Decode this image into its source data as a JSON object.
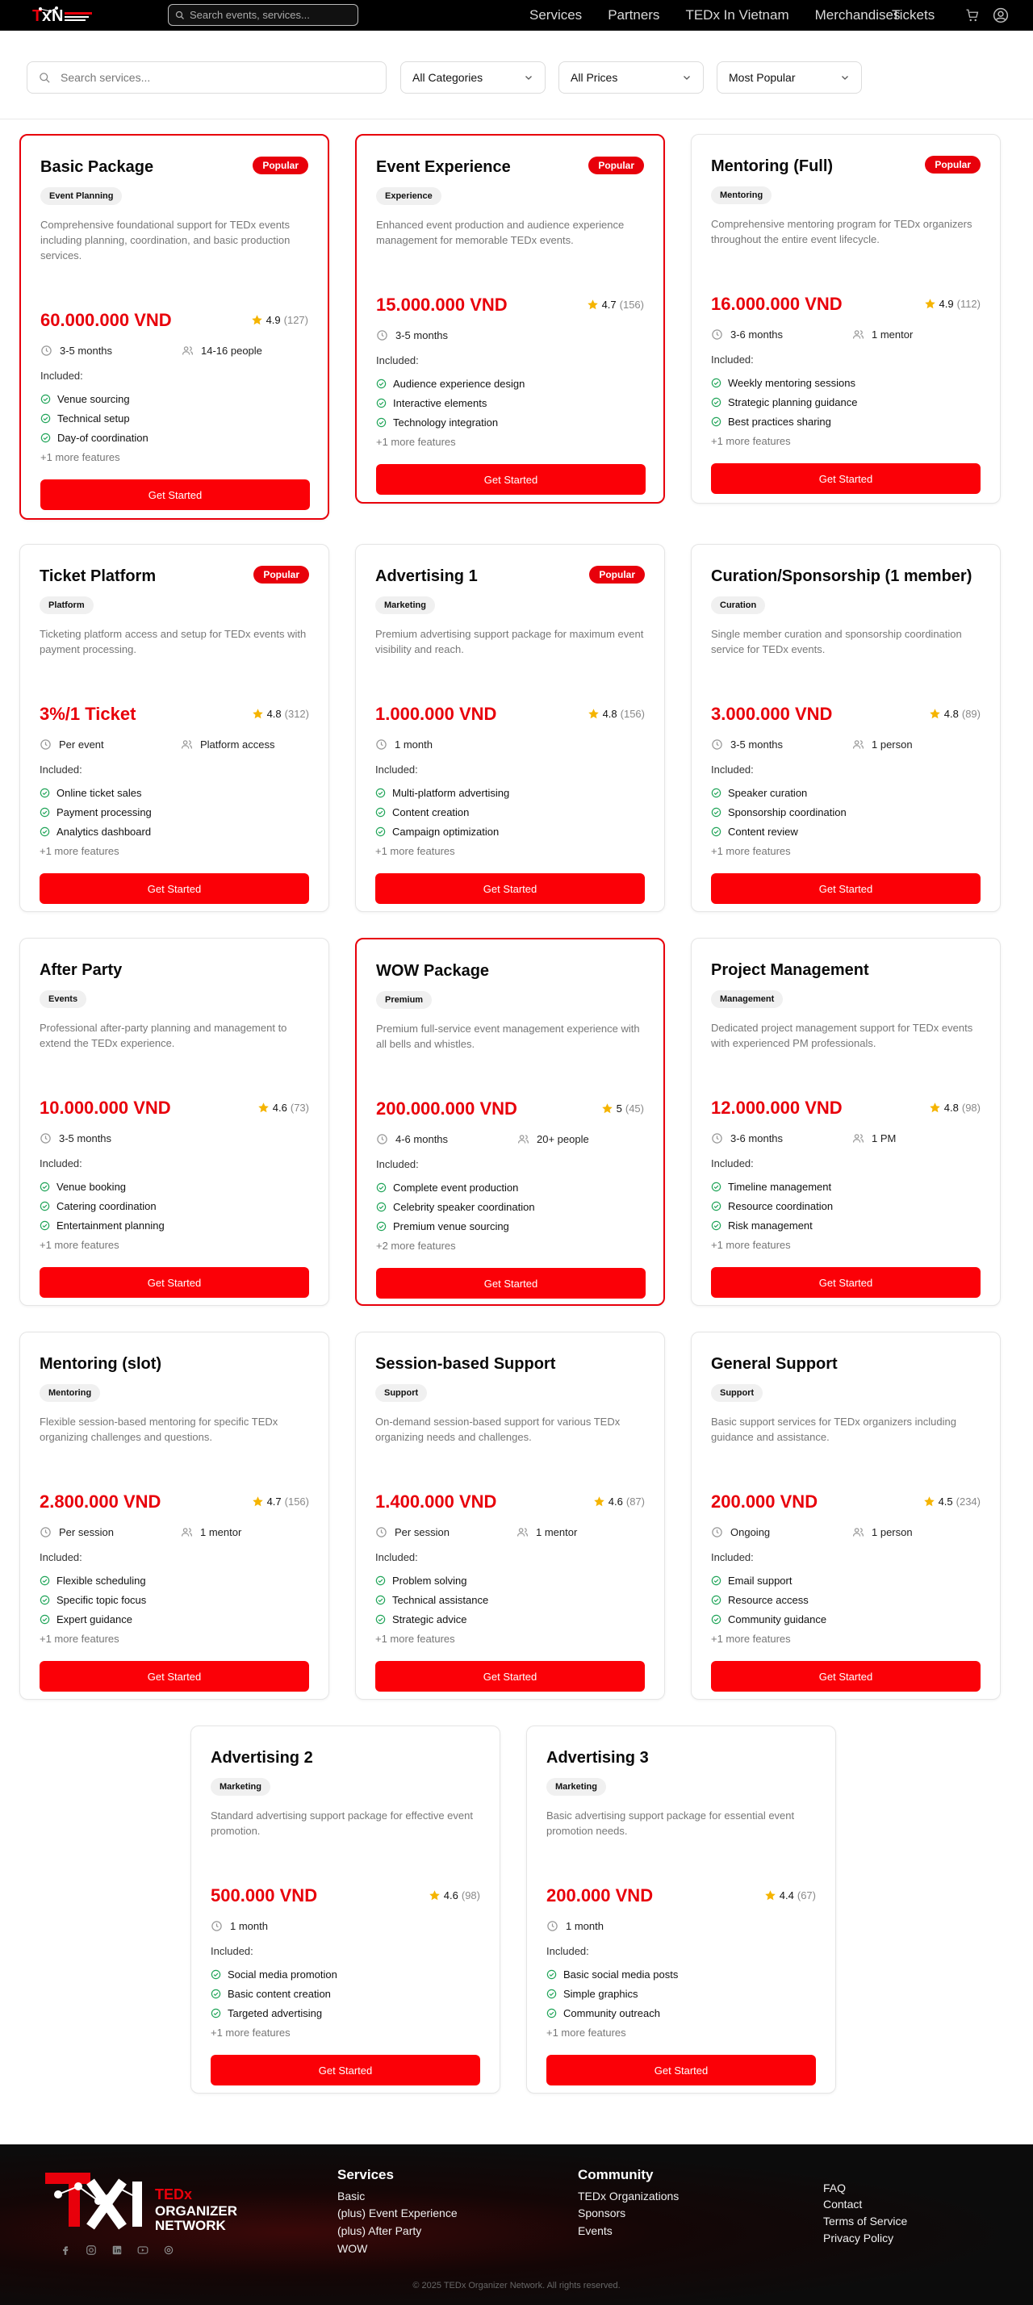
{
  "nav": {
    "search_placeholder": "Search events, services...",
    "links": [
      "Services",
      "Partners",
      "TEDx In Vietnam",
      "Merchandises"
    ],
    "tickets": "Tickets"
  },
  "filters": {
    "search_placeholder": "Search services...",
    "category": "All Categories",
    "price": "All Prices",
    "sort": "Most Popular"
  },
  "common": {
    "included_label": "Included:",
    "button_label": "Get Started",
    "popular_label": "Popular"
  },
  "services": [
    {
      "title": "Basic Package",
      "popular": true,
      "category": "Event Planning",
      "description": "Comprehensive foundational support for TEDx events including planning, coordination, and basic production services.",
      "price": "60.000.000 VND",
      "rating": "4.9",
      "reviews": "(127)",
      "duration": "3-5 months",
      "team": "14-16 people",
      "features": [
        "Venue sourcing",
        "Technical setup",
        "Day-of coordination"
      ],
      "more": "+1 more features"
    },
    {
      "title": "Event Experience",
      "popular": true,
      "category": "Experience",
      "description": "Enhanced event production and audience experience management for memorable TEDx events.",
      "price": "15.000.000 VND",
      "rating": "4.7",
      "reviews": "(156)",
      "duration": "3-5 months",
      "team": "",
      "features": [
        "Audience experience design",
        "Interactive elements",
        "Technology integration"
      ],
      "more": "+1 more features"
    },
    {
      "title": "Mentoring (Full)",
      "popular": true,
      "category": "Mentoring",
      "description": "Comprehensive mentoring program for TEDx organizers throughout the entire event lifecycle.",
      "price": "16.000.000 VND",
      "rating": "4.9",
      "reviews": "(112)",
      "duration": "3-6 months",
      "team": "1 mentor",
      "features": [
        "Weekly mentoring sessions",
        "Strategic planning guidance",
        "Best practices sharing"
      ],
      "more": "+1 more features"
    },
    {
      "title": "Ticket Platform",
      "popular": true,
      "category": "Platform",
      "description": "Ticketing platform access and setup for TEDx events with payment processing.",
      "price": "3%/1 Ticket",
      "rating": "4.8",
      "reviews": "(312)",
      "duration": "Per event",
      "team": "Platform access",
      "features": [
        "Online ticket sales",
        "Payment processing",
        "Analytics dashboard"
      ],
      "more": "+1 more features"
    },
    {
      "title": "Advertising 1",
      "popular": true,
      "category": "Marketing",
      "description": "Premium advertising support package for maximum event visibility and reach.",
      "price": "1.000.000 VND",
      "rating": "4.8",
      "reviews": "(156)",
      "duration": "1 month",
      "team": "",
      "features": [
        "Multi-platform advertising",
        "Content creation",
        "Campaign optimization"
      ],
      "more": "+1 more features"
    },
    {
      "title": "Curation/Sponsorship (1 member)",
      "popular": false,
      "category": "Curation",
      "description": "Single member curation and sponsorship coordination service for TEDx events.",
      "price": "3.000.000 VND",
      "rating": "4.8",
      "reviews": "(89)",
      "duration": "3-5 months",
      "team": "1 person",
      "features": [
        "Speaker curation",
        "Sponsorship coordination",
        "Content review"
      ],
      "more": "+1 more features"
    },
    {
      "title": "After Party",
      "popular": false,
      "category": "Events",
      "description": "Professional after-party planning and management to extend the TEDx experience.",
      "price": "10.000.000 VND",
      "rating": "4.6",
      "reviews": "(73)",
      "duration": "3-5 months",
      "team": "",
      "features": [
        "Venue booking",
        "Catering coordination",
        "Entertainment planning"
      ],
      "more": "+1 more features"
    },
    {
      "title": "WOW Package",
      "popular": false,
      "category": "Premium",
      "description": "Premium full-service event management experience with all bells and whistles.",
      "price": "200.000.000 VND",
      "rating": "5",
      "reviews": "(45)",
      "duration": "4-6 months",
      "team": "20+ people",
      "features": [
        "Complete event production",
        "Celebrity speaker coordination",
        "Premium venue sourcing"
      ],
      "more": "+2 more features"
    },
    {
      "title": "Project Management",
      "popular": false,
      "category": "Management",
      "description": "Dedicated project management support for TEDx events with experienced PM professionals.",
      "price": "12.000.000 VND",
      "rating": "4.8",
      "reviews": "(98)",
      "duration": "3-6 months",
      "team": "1 PM",
      "features": [
        "Timeline management",
        "Resource coordination",
        "Risk management"
      ],
      "more": "+1 more features"
    },
    {
      "title": "Mentoring (slot)",
      "popular": false,
      "category": "Mentoring",
      "description": "Flexible session-based mentoring for specific TEDx organizing challenges and questions.",
      "price": "2.800.000 VND",
      "rating": "4.7",
      "reviews": "(156)",
      "duration": "Per session",
      "team": "1 mentor",
      "features": [
        "Flexible scheduling",
        "Specific topic focus",
        "Expert guidance"
      ],
      "more": "+1 more features"
    },
    {
      "title": "Session-based Support",
      "popular": false,
      "category": "Support",
      "description": "On-demand session-based support for various TEDx organizing needs and challenges.",
      "price": "1.400.000 VND",
      "rating": "4.6",
      "reviews": "(87)",
      "duration": "Per session",
      "team": "1 mentor",
      "features": [
        "Problem solving",
        "Technical assistance",
        "Strategic advice"
      ],
      "more": "+1 more features"
    },
    {
      "title": "General Support",
      "popular": false,
      "category": "Support",
      "description": "Basic support services for TEDx organizers including guidance and assistance.",
      "price": "200.000 VND",
      "rating": "4.5",
      "reviews": "(234)",
      "duration": "Ongoing",
      "team": "1 person",
      "features": [
        "Email support",
        "Resource access",
        "Community guidance"
      ],
      "more": "+1 more features"
    },
    {
      "title": "Advertising 2",
      "popular": false,
      "category": "Marketing",
      "description": "Standard advertising support package for effective event promotion.",
      "price": "500.000 VND",
      "rating": "4.6",
      "reviews": "(98)",
      "duration": "1 month",
      "team": "",
      "features": [
        "Social media promotion",
        "Basic content creation",
        "Targeted advertising"
      ],
      "more": "+1 more features"
    },
    {
      "title": "Advertising 3",
      "popular": false,
      "category": "Marketing",
      "description": "Basic advertising support package for essential event promotion needs.",
      "price": "200.000 VND",
      "rating": "4.4",
      "reviews": "(67)",
      "duration": "1 month",
      "team": "",
      "features": [
        "Basic social media posts",
        "Simple graphics",
        "Community outreach"
      ],
      "more": "+1 more features"
    }
  ],
  "footer": {
    "logo_text": [
      "TEDx",
      "ORGANIZER",
      "NETWORK"
    ],
    "services_title": "Services",
    "services_links": [
      "Basic",
      "(plus) Event Experience",
      "(plus) After Party",
      "WOW"
    ],
    "community_title": "Community",
    "community_links": [
      "TEDx Organizations",
      "Sponsors",
      "Events"
    ],
    "help_links": [
      "FAQ",
      "Contact",
      "Terms of Service",
      "Privacy Policy"
    ],
    "copyright": "© 2025 TEDx Organizer Network. All rights reserved."
  },
  "colors": {
    "accent": "#e8000b",
    "button": "#fb0007",
    "star": "#f5b400",
    "check": "#22a55a"
  },
  "icons": [
    "search-icon",
    "chevron-down-icon",
    "clock-icon",
    "users-icon",
    "star-icon",
    "check-circle-icon",
    "cart-icon",
    "user-icon",
    "facebook-icon",
    "instagram-icon",
    "linkedin-icon",
    "youtube-icon",
    "threads-icon"
  ]
}
